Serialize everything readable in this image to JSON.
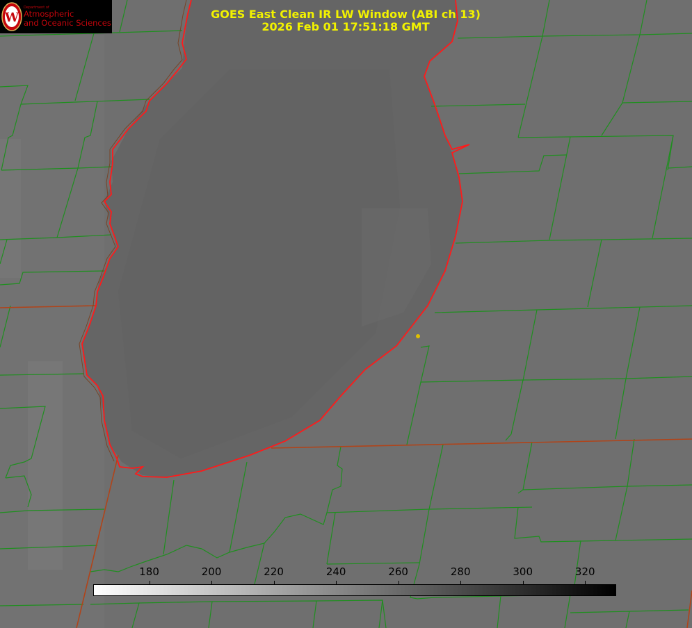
{
  "title": {
    "line1": "GOES East Clean IR LW Window (ABI ch 13)",
    "line2": "2026 Feb 01 17:51:18 GMT"
  },
  "logo": {
    "department": "Department of",
    "line1": "Atmospheric",
    "line2": "and Oceanic Sciences",
    "seal_letter": "W",
    "icon": "uw-crest-icon"
  },
  "colorbar": {
    "min": 162,
    "max": 330,
    "ticks": [
      {
        "label": "180",
        "value": 180
      },
      {
        "label": "200",
        "value": 200
      },
      {
        "label": "220",
        "value": 220
      },
      {
        "label": "240",
        "value": 240
      },
      {
        "label": "260",
        "value": 260
      },
      {
        "label": "280",
        "value": 280
      },
      {
        "label": "300",
        "value": 300
      },
      {
        "label": "320",
        "value": 320
      }
    ],
    "colors": {
      "start": "#ffffff",
      "end": "#000000"
    }
  },
  "colors": {
    "background": "#6f6f6f",
    "lake": "#656565",
    "county_lines": "#1f8f1f",
    "shoreline": "#ff1a1a",
    "state_lines": "#b0441a",
    "title_text": "#f2f200",
    "station_marker": "#e0c000"
  }
}
